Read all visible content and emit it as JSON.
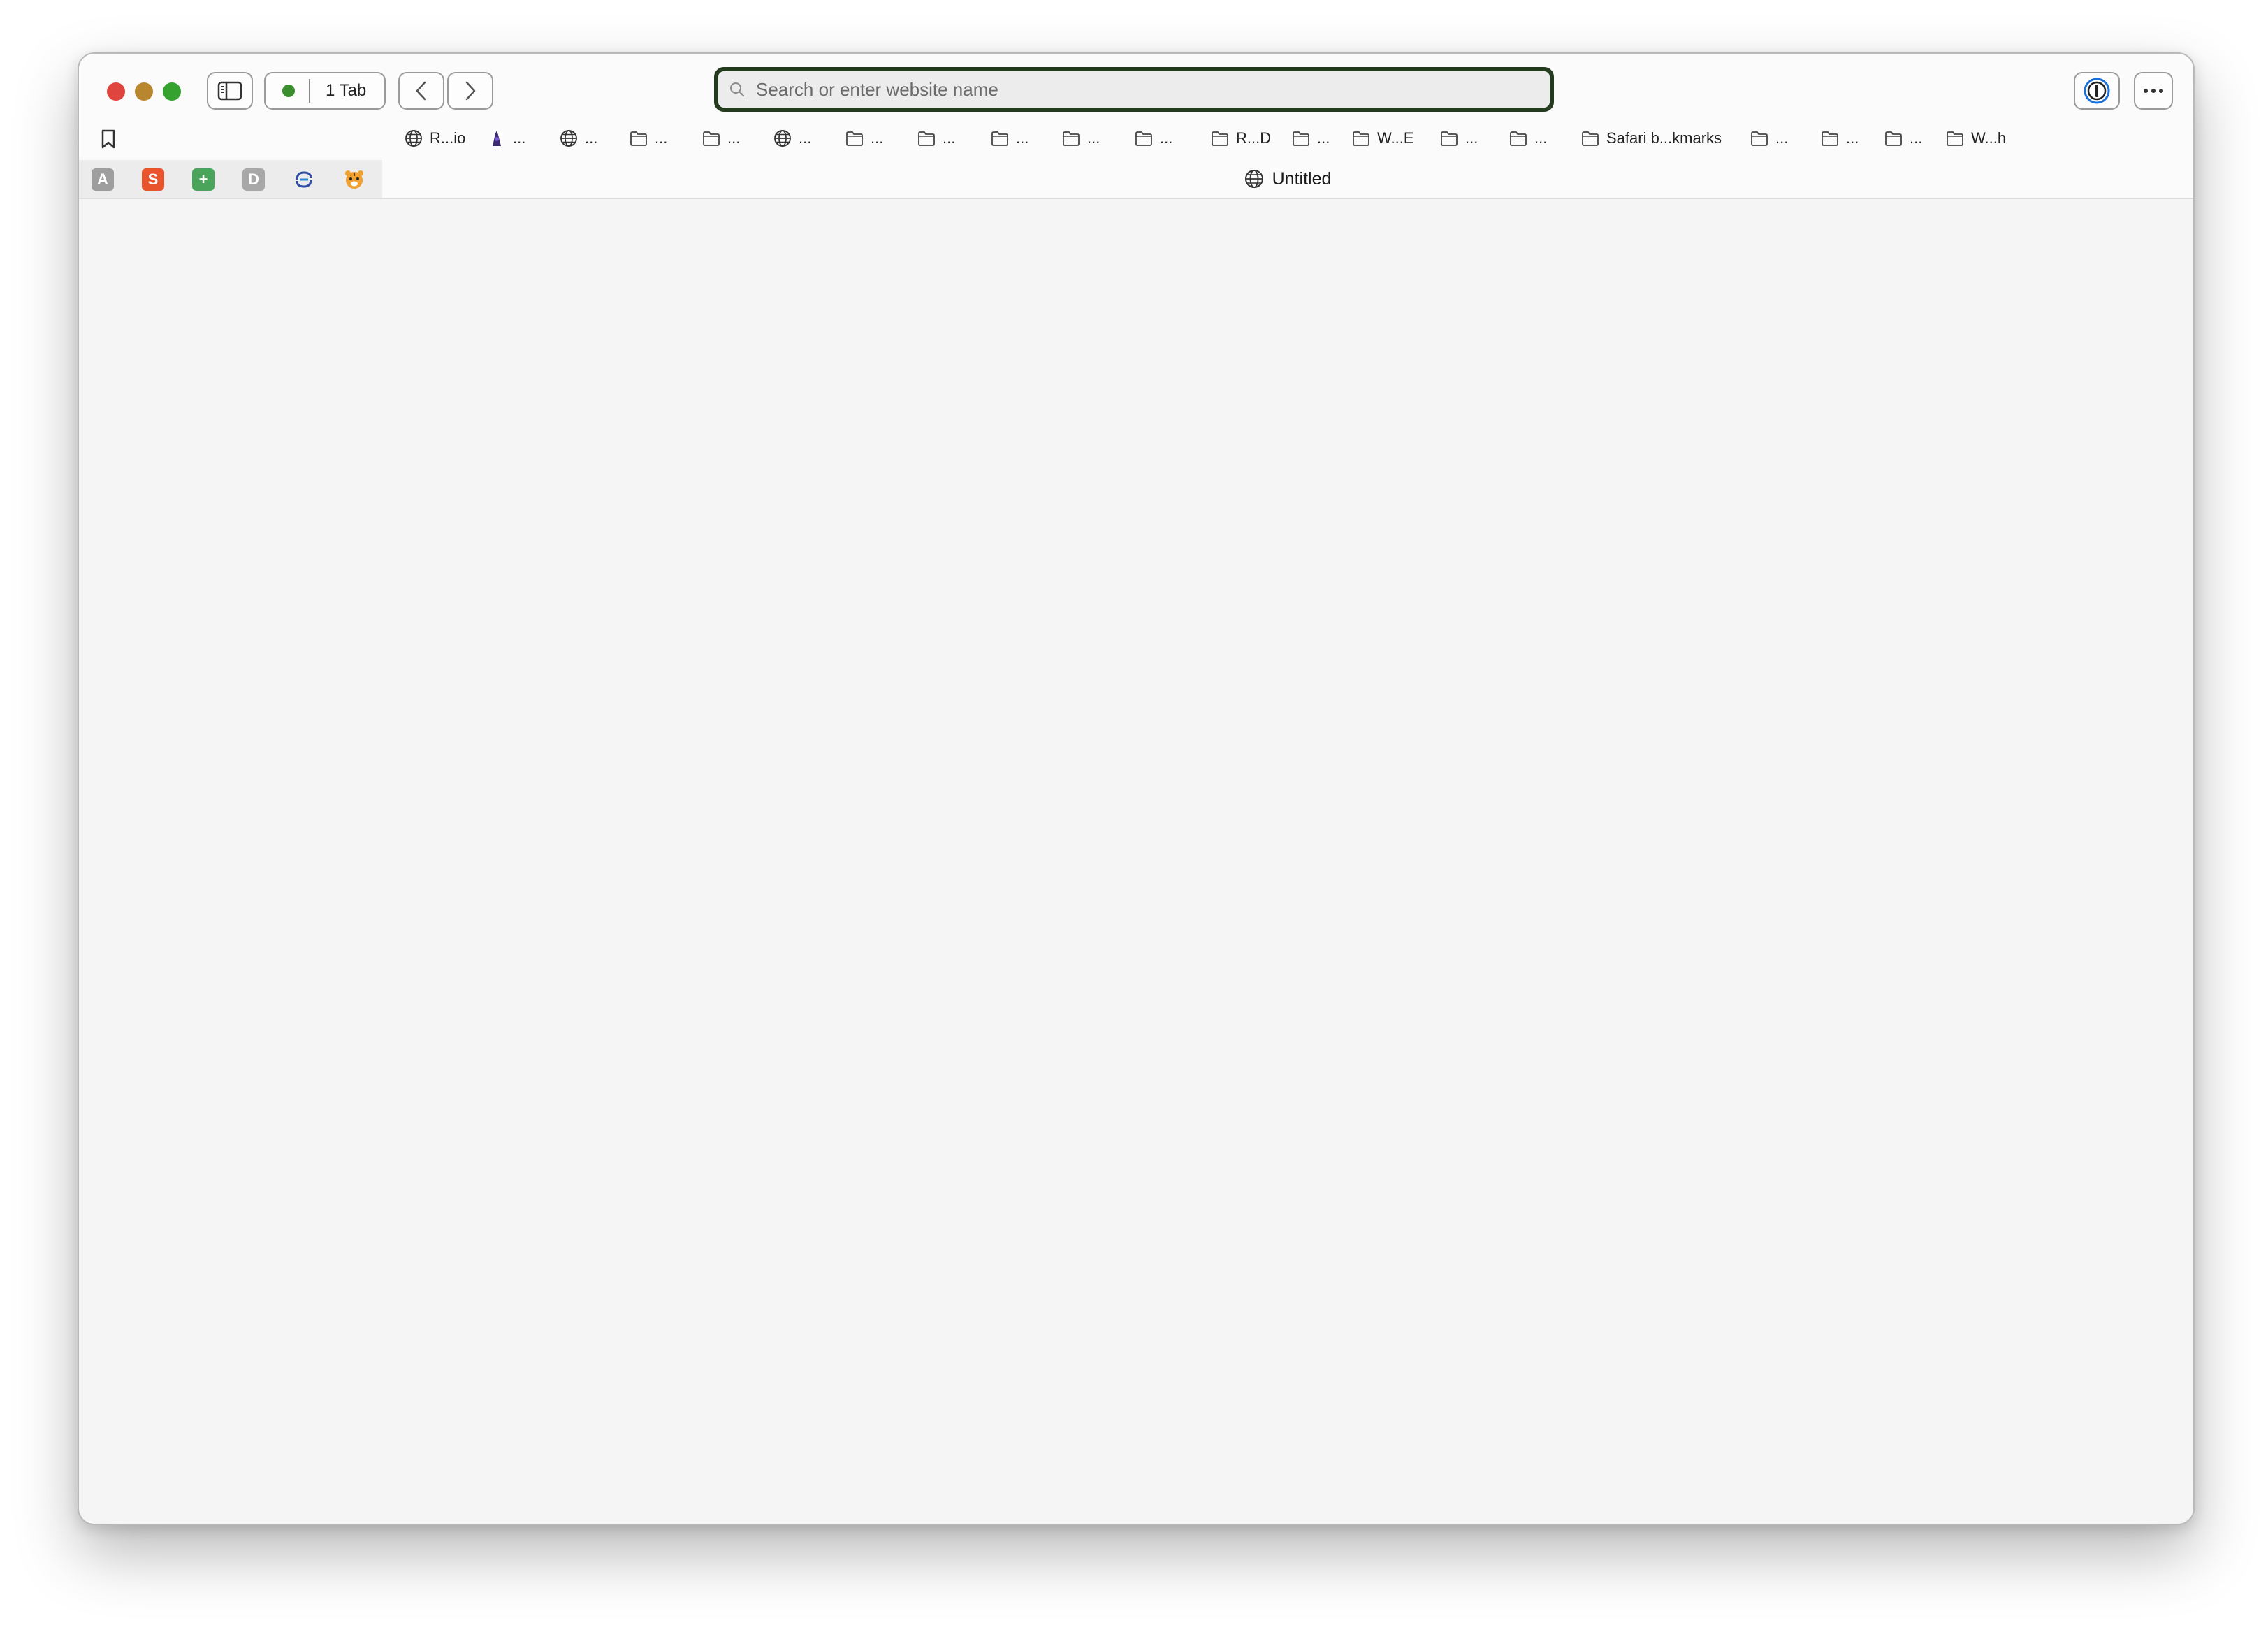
{
  "toolbar": {
    "tab_count_label": "1 Tab",
    "address_placeholder": "Search or enter website name"
  },
  "bookmarks": [
    {
      "icon": "globe-icon",
      "label": "R...io"
    },
    {
      "icon": "app-icon",
      "label": "..."
    },
    {
      "icon": "globe-icon",
      "label": "..."
    },
    {
      "icon": "folder-icon",
      "label": "..."
    },
    {
      "icon": "folder-icon",
      "label": "..."
    },
    {
      "icon": "globe-icon",
      "label": "..."
    },
    {
      "icon": "folder-icon",
      "label": "..."
    },
    {
      "icon": "folder-icon",
      "label": "..."
    },
    {
      "icon": "folder-icon",
      "label": "..."
    },
    {
      "icon": "folder-icon",
      "label": "..."
    },
    {
      "icon": "folder-icon",
      "label": "..."
    },
    {
      "icon": "folder-icon",
      "label": "R...D"
    },
    {
      "icon": "folder-icon",
      "label": "..."
    },
    {
      "icon": "folder-icon",
      "label": "W...E"
    },
    {
      "icon": "folder-icon",
      "label": "..."
    },
    {
      "icon": "folder-icon",
      "label": "..."
    },
    {
      "icon": "folder-icon",
      "label": "Safari b...kmarks"
    },
    {
      "icon": "folder-icon",
      "label": "..."
    },
    {
      "icon": "folder-icon",
      "label": "..."
    },
    {
      "icon": "folder-icon",
      "label": "..."
    },
    {
      "icon": "folder-icon",
      "label": "W...h"
    }
  ],
  "pinned_tabs": [
    {
      "icon": "letter-a-icon",
      "glyph": "A",
      "color": "#9e9e9e"
    },
    {
      "icon": "s-logo-icon",
      "glyph": "S",
      "color": "#e8542c"
    },
    {
      "icon": "plus-tile-icon",
      "glyph": "+",
      "color": "#4aa55a"
    },
    {
      "icon": "letter-d-icon",
      "glyph": "D",
      "color": "#a8a8a8"
    },
    {
      "icon": "swirl-logo-icon",
      "glyph": "",
      "color": "#2f4ea8"
    },
    {
      "icon": "tiger-icon",
      "glyph": "",
      "color": "#f0a030"
    }
  ],
  "active_tab": {
    "title": "Untitled"
  },
  "colors": {
    "close": "#e0443e",
    "minimize": "#b8862f",
    "zoom": "#35a12e",
    "address_focus_ring": "#243a1e"
  }
}
